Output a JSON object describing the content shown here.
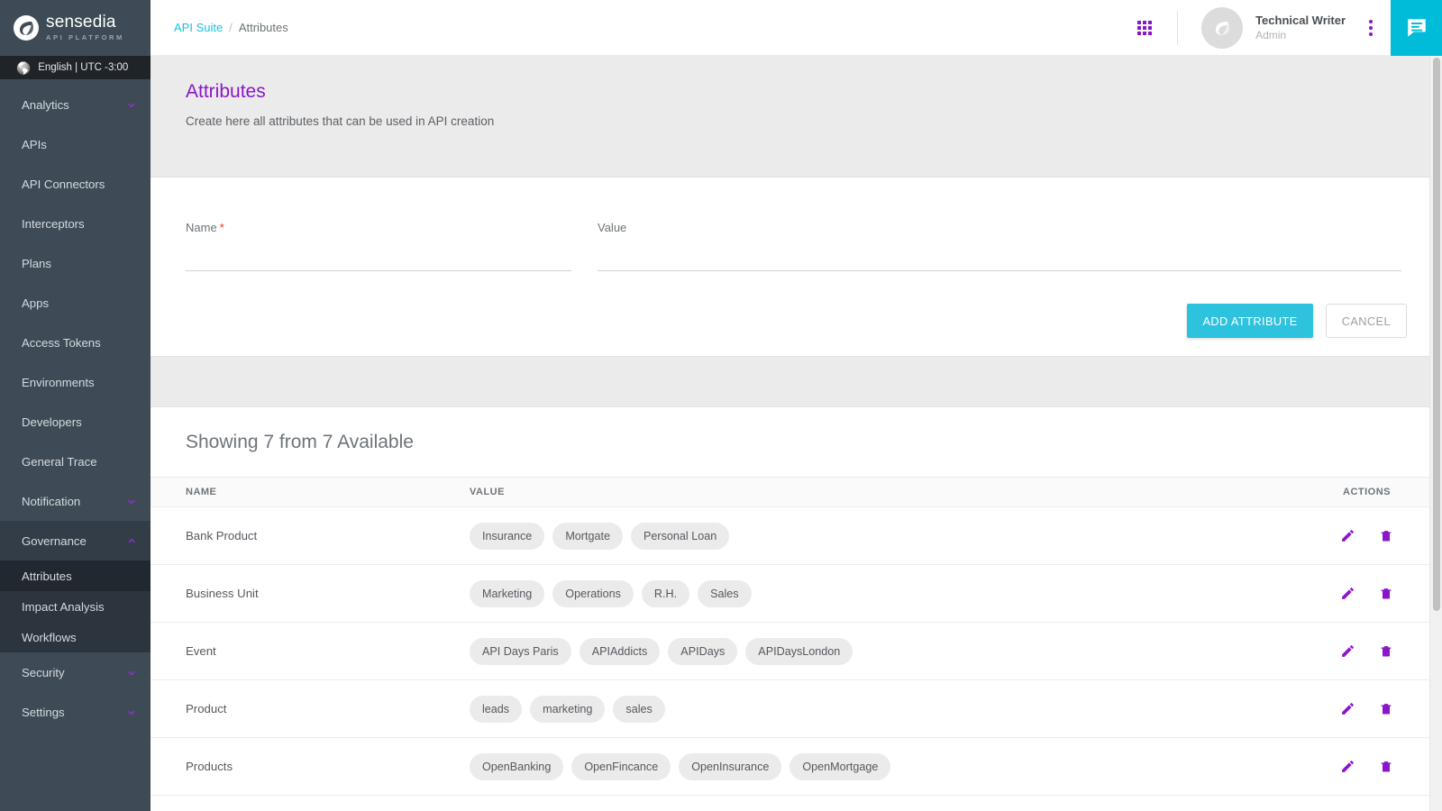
{
  "brand": {
    "name": "sensedia",
    "subtitle": "API PLATFORM",
    "logo_icon": "sensedia-leaf-logo"
  },
  "locale_bar": {
    "icon": "globe-icon",
    "label": "English | UTC -3:00"
  },
  "sidebar": {
    "items": [
      {
        "label": "Analytics",
        "expandable": true,
        "expanded": false
      },
      {
        "label": "APIs",
        "expandable": false,
        "expanded": false
      },
      {
        "label": "API Connectors",
        "expandable": false,
        "expanded": false
      },
      {
        "label": "Interceptors",
        "expandable": false,
        "expanded": false
      },
      {
        "label": "Plans",
        "expandable": false,
        "expanded": false
      },
      {
        "label": "Apps",
        "expandable": false,
        "expanded": false
      },
      {
        "label": "Access Tokens",
        "expandable": false,
        "expanded": false
      },
      {
        "label": "Environments",
        "expandable": false,
        "expanded": false
      },
      {
        "label": "Developers",
        "expandable": false,
        "expanded": false
      },
      {
        "label": "General Trace",
        "expandable": false,
        "expanded": false
      },
      {
        "label": "Notification",
        "expandable": true,
        "expanded": false
      },
      {
        "label": "Governance",
        "expandable": true,
        "expanded": true
      }
    ],
    "governance_children": [
      {
        "label": "Attributes",
        "active": true
      },
      {
        "label": "Impact Analysis",
        "active": false
      },
      {
        "label": "Workflows",
        "active": false
      }
    ],
    "tail_items": [
      {
        "label": "Security",
        "expandable": true,
        "expanded": false
      },
      {
        "label": "Settings",
        "expandable": true,
        "expanded": false
      }
    ]
  },
  "topbar": {
    "breadcrumb": {
      "root": "API Suite",
      "separator": "/",
      "current": "Attributes"
    },
    "apps_icon": "apps-grid-icon",
    "avatar_icon": "user-avatar-icon",
    "user_name": "Technical Writer",
    "user_role": "Admin",
    "kebab_icon": "more-vertical-icon",
    "chat_icon": "chat-bubble-icon"
  },
  "page": {
    "title": "Attributes",
    "description": "Create here all attributes that can be used in API creation"
  },
  "form": {
    "name_label": "Name",
    "name_required_mark": "*",
    "name_value": "",
    "name_placeholder": "",
    "value_label": "Value",
    "value_value": "",
    "value_placeholder": "",
    "add_label": "ADD ATTRIBUTE",
    "cancel_label": "CANCEL"
  },
  "list": {
    "summary": "Showing 7 from 7 Available",
    "columns": {
      "name": "NAME",
      "value": "VALUE",
      "actions": "ACTIONS"
    },
    "edit_icon": "pencil-edit-icon",
    "delete_icon": "trash-delete-icon",
    "rows": [
      {
        "name": "Bank Product",
        "values": [
          "Insurance",
          "Mortgate",
          "Personal Loan"
        ]
      },
      {
        "name": "Business Unit",
        "values": [
          "Marketing",
          "Operations",
          "R.H.",
          "Sales"
        ]
      },
      {
        "name": "Event",
        "values": [
          "API Days Paris",
          "APIAddicts",
          "APIDays",
          "APIDaysLondon"
        ]
      },
      {
        "name": "Product",
        "values": [
          "leads",
          "marketing",
          "sales"
        ]
      },
      {
        "name": "Products",
        "values": [
          "OpenBanking",
          "OpenFincance",
          "OpenInsurance",
          "OpenMortgage"
        ]
      }
    ]
  },
  "colors": {
    "sidebar_bg": "#3e4b57",
    "accent_purple": "#8b16c9",
    "accent_cyan": "#00bcd9",
    "primary_button": "#2dc2dd",
    "required_red": "#e53935"
  }
}
